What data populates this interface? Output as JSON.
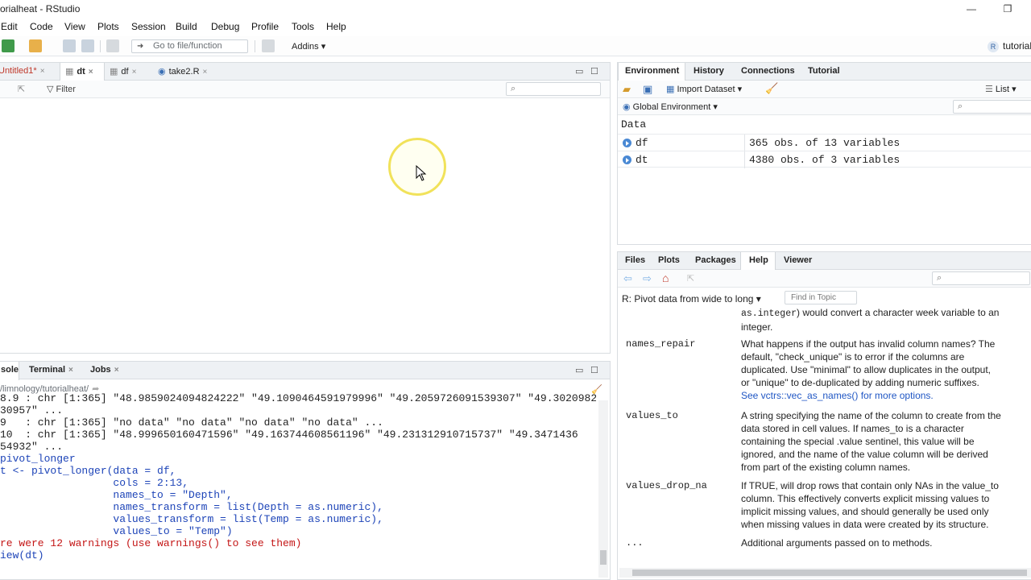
{
  "window": {
    "title": "orialheat - RStudio",
    "restore_glyph": "❐",
    "minimize_glyph": "—"
  },
  "menu": [
    "Edit",
    "Code",
    "View",
    "Plots",
    "Session",
    "Build",
    "Debug",
    "Profile",
    "Tools",
    "Help"
  ],
  "toolbar": {
    "goto_placeholder": "Go to file/function",
    "addins_label": "Addins ▾",
    "project_label": "tutorial",
    "project_badge": "R"
  },
  "source": {
    "tabs": [
      {
        "label": "Untitled1*",
        "close": "×"
      },
      {
        "label": "dt",
        "close": "×"
      },
      {
        "label": "df",
        "close": "×"
      },
      {
        "label": "take2.R",
        "close": "×"
      }
    ],
    "filter_label": "Filter"
  },
  "console": {
    "tabs": [
      {
        "label": "sole"
      },
      {
        "label": "Terminal",
        "close": "×"
      },
      {
        "label": "Jobs",
        "close": "×"
      }
    ],
    "path": "/limnology/tutorialheat/",
    "lines": [
      {
        "kind": "out",
        "text": "8.9 : chr [1:365] \"48.9859024094824222\" \"49.1090464591979996\" \"49.2059726091539307\" \"49.3020982"
      },
      {
        "kind": "out",
        "text": "30957\" ..."
      },
      {
        "kind": "out",
        "text": "9   : chr [1:365] \"no data\" \"no data\" \"no data\" \"no data\" ..."
      },
      {
        "kind": "out",
        "text": "10  : chr [1:365] \"48.999650160471596\" \"49.163744608561196\" \"49.231312910715737\" \"49.3471436"
      },
      {
        "kind": "out",
        "text": "54932\" ..."
      },
      {
        "kind": "in",
        "text": "pivot_longer"
      },
      {
        "kind": "in",
        "text": "t <- pivot_longer(data = df,"
      },
      {
        "kind": "in",
        "text": "                  cols = 2:13,"
      },
      {
        "kind": "in",
        "text": "                  names_to = \"Depth\","
      },
      {
        "kind": "in",
        "text": "                  names_transform = list(Depth = as.numeric),"
      },
      {
        "kind": "in",
        "text": "                  values_transform = list(Temp = as.numeric),"
      },
      {
        "kind": "in",
        "text": "                  values_to = \"Temp\")"
      },
      {
        "kind": "err",
        "text": "re were 12 warnings (use warnings() to see them)"
      },
      {
        "kind": "in",
        "text": "iew(dt)"
      }
    ]
  },
  "environment": {
    "tabs": [
      "Environment",
      "History",
      "Connections",
      "Tutorial"
    ],
    "import_label": "Import Dataset ▾",
    "list_label": "List ▾",
    "scope_label": "Global Environment ▾",
    "section": "Data",
    "rows": [
      {
        "name": "df",
        "value": "365 obs. of 13 variables"
      },
      {
        "name": "dt",
        "value": "4380 obs. of 3 variables"
      }
    ]
  },
  "help": {
    "tabs": [
      "Files",
      "Plots",
      "Packages",
      "Help",
      "Viewer"
    ],
    "title": "R: Pivot data from wide to long ▾",
    "find_placeholder": "Find in Topic",
    "args": [
      {
        "name": "",
        "lines": [
          {
            "t": "as.integer",
            "code": true
          },
          {
            "t": ") would convert a character week variable to an"
          },
          {
            "t": "integer.",
            "br": true
          }
        ]
      },
      {
        "name": "names_repair",
        "desc": [
          "What happens if the output has invalid column names? The",
          "default, \"check_unique\" is to error if the columns are",
          "duplicated. Use \"minimal\" to allow duplicates in the output,",
          "or \"unique\" to de-duplicated by adding numeric suffixes.",
          "See vctrs::vec_as_names() for more options."
        ]
      },
      {
        "name": "values_to",
        "desc": [
          "A string specifying the name of the column to create from the",
          "data stored in cell values. If names_to is a character",
          "containing the special .value sentinel, this value will be",
          "ignored, and the name of the value column will be derived",
          "from part of the existing column names."
        ]
      },
      {
        "name": "values_drop_na",
        "desc": [
          "If TRUE, will drop rows that contain only NAs in the value_to",
          "column. This effectively converts explicit missing values to",
          "implicit missing values, and should generally be used only",
          "when missing values in data were created by its structure."
        ]
      },
      {
        "name": "...",
        "desc": [
          "Additional arguments passed on to methods."
        ]
      }
    ]
  },
  "colors": {
    "accent": "#4a89d4",
    "console_input": "#1d44b8",
    "console_error": "#c41616",
    "cursor_ring": "#f1e25a"
  }
}
